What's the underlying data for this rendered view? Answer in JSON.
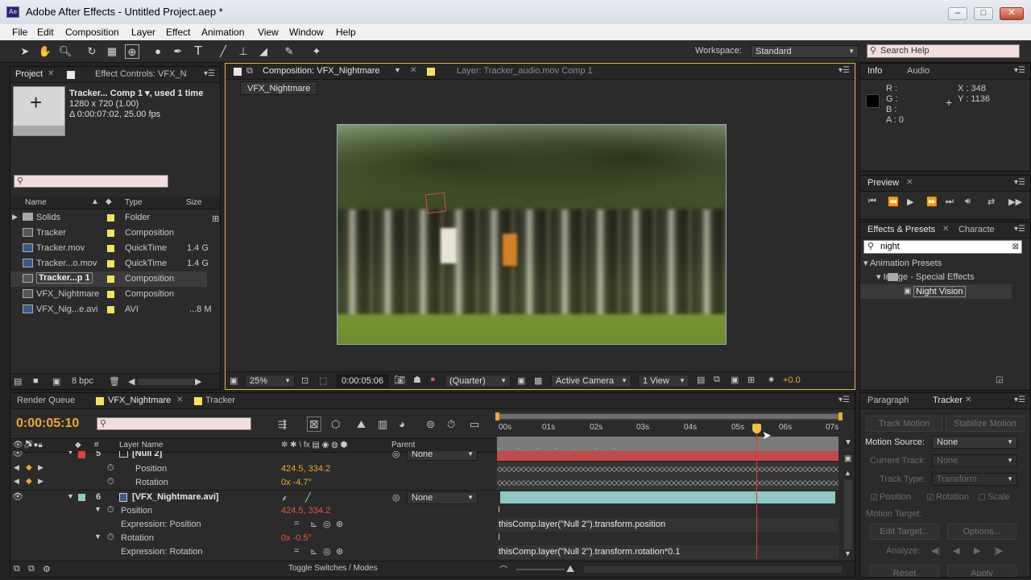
{
  "window": {
    "title": "Adobe After Effects - Untitled Project.aep *",
    "app_icon": "Ae",
    "min": "–",
    "max": "□",
    "close": "✕"
  },
  "menu": [
    "File",
    "Edit",
    "Composition",
    "Layer",
    "Effect",
    "Animation",
    "View",
    "Window",
    "Help"
  ],
  "toolbar": {
    "workspace_label": "Workspace:",
    "workspace_value": "Standard",
    "search_help": "Search Help"
  },
  "project": {
    "tab_project": "Project",
    "tab_effect_controls": "Effect Controls: VFX_N",
    "item_name": "Tracker... Comp 1 ▾, used 1 time",
    "item_dims": "1280 x 720 (1.00)",
    "item_duration": "Δ 0:00:07:02, 25.00 fps",
    "col_name": "Name",
    "col_type": "Type",
    "col_size": "Size",
    "items": [
      {
        "name": "Solids",
        "type": "Folder",
        "size": ""
      },
      {
        "name": "Tracker",
        "type": "Composition",
        "size": ""
      },
      {
        "name": "Tracker.mov",
        "type": "QuickTime",
        "size": "1.4 G"
      },
      {
        "name": "Tracker...o.mov",
        "type": "QuickTime",
        "size": "1.4 G"
      },
      {
        "name": "Tracker...p 1",
        "type": "Composition",
        "size": ""
      },
      {
        "name": "VFX_Nightmare",
        "type": "Composition",
        "size": ""
      },
      {
        "name": "VFX_Nig...e.avi",
        "type": "AVI",
        "size": "...8 M"
      }
    ],
    "bpc": "8 bpc"
  },
  "comp_viewer": {
    "tab_comp": "Composition: VFX_Nightmare",
    "tab_layer": "Layer: Tracker_audio.mov Comp 1",
    "sub_tab": "VFX_Nightmare",
    "zoom": "25%",
    "timecode": "0:00:05:06",
    "resolution": "(Quarter)",
    "camera": "Active Camera",
    "views": "1 View",
    "exposure": "+0.0"
  },
  "info": {
    "tab_info": "Info",
    "tab_audio": "Audio",
    "r": "R :",
    "g": "G :",
    "b": "B :",
    "a": "A : 0",
    "x": "X : 348",
    "y": "Y : 1136"
  },
  "preview": {
    "tab": "Preview"
  },
  "effects": {
    "tab": "Effects & Presets",
    "tab2": "Characte",
    "search": "night",
    "tree": [
      "▾ Animation Presets",
      "▾  Image - Special Effects",
      "Night Vision"
    ]
  },
  "timeline": {
    "tab_render": "Render Queue",
    "tab_comp": "VFX_Nightmare",
    "tab_tracker": "Tracker",
    "timecode": "0:00:05:10",
    "col_layer_name": "Layer Name",
    "col_parent": "Parent",
    "col_num": "#",
    "ruler": [
      "00s",
      "01s",
      "02s",
      "03s",
      "04s",
      "05s",
      "06s",
      "07s"
    ],
    "toggle": "Toggle Switches / Modes",
    "layers": [
      {
        "num": "5",
        "name": "[Null 2]",
        "parent": "None"
      },
      {
        "prop": "Position",
        "value": "424.5, 334.2"
      },
      {
        "prop": "Rotation",
        "value": "0x -4.7°"
      },
      {
        "num": "6",
        "name": "[VFX_Nightmare.avi]",
        "parent": "None"
      },
      {
        "prop": "Position",
        "value": "424.5, 334.2"
      },
      {
        "prop": "Expression: Position",
        "expr": "thisComp.layer(\"Null 2\").transform.position"
      },
      {
        "prop": "Rotation",
        "value": "0x -0.5°"
      },
      {
        "prop": "Expression: Rotation",
        "expr": "thisComp.layer(\"Null 2\").transform.rotation*0.1"
      }
    ]
  },
  "right_bottom": {
    "tab_paragraph": "Paragraph",
    "tab_tracker": "Tracker",
    "track_motion": "Track Motion",
    "stabilize": "Stabilize Motion",
    "motion_source_label": "Motion Source:",
    "motion_source": "None",
    "current_track_label": "Current Track:",
    "current_track": "None",
    "track_type_label": "Track Type:",
    "track_type": "Transform",
    "position": "Position",
    "rotation": "Rotation",
    "scale": "Scale",
    "motion_target": "Motion Target:",
    "edit_target": "Edit Target...",
    "options": "Options...",
    "analyze": "Analyze:",
    "reset": "Reset",
    "apply": "Apply"
  },
  "colors": {
    "accent": "#f0a630",
    "label_red": "#e2403a",
    "label_teal": "#8fc7c5",
    "playhead": "#e63a2a",
    "search_bg": "#f2dede"
  }
}
